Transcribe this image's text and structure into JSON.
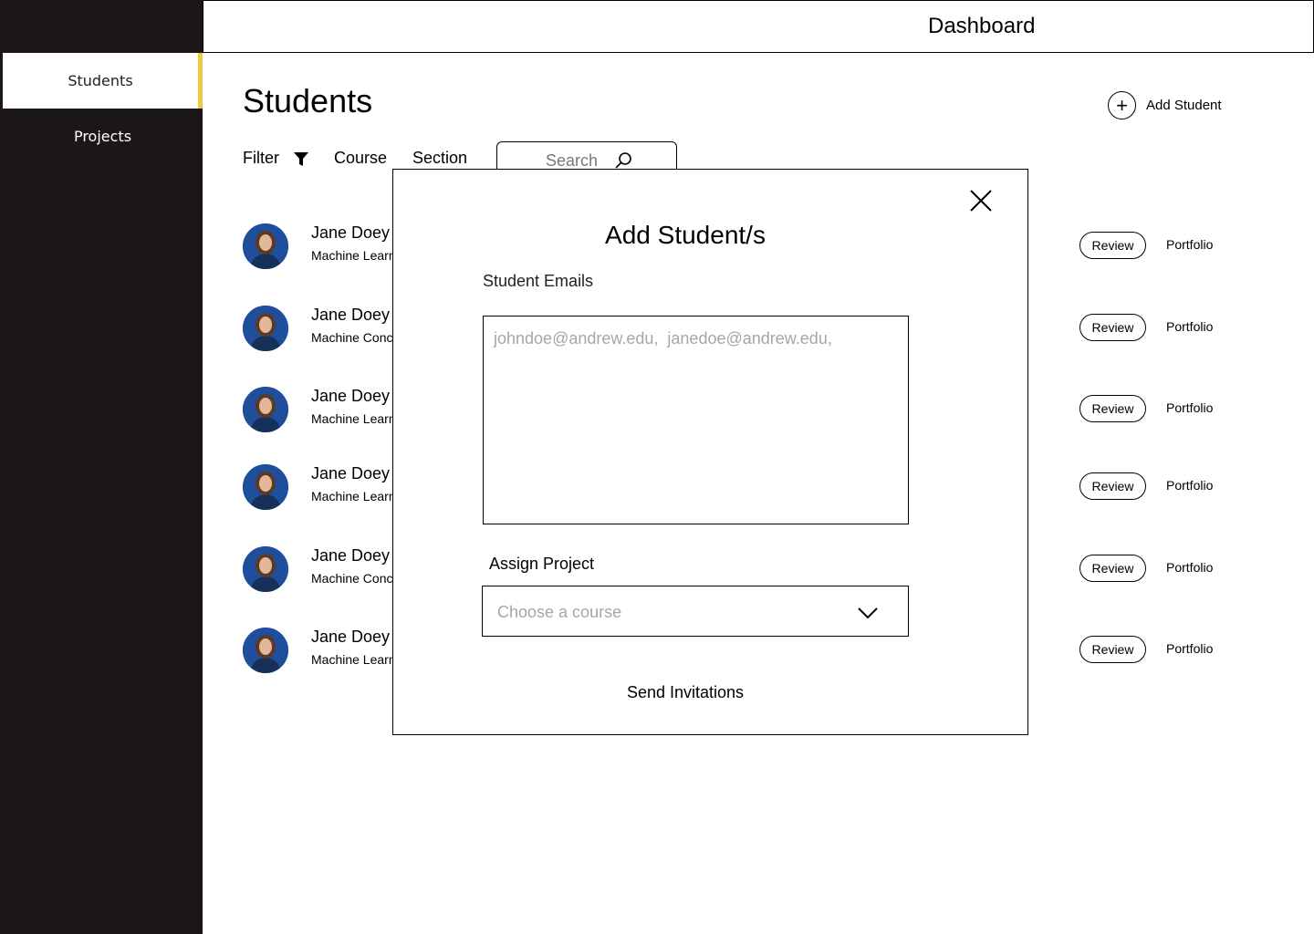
{
  "header": {
    "title": "Dashboard"
  },
  "sidebar": {
    "items": [
      {
        "label": "Students",
        "active": true
      },
      {
        "label": "Projects",
        "active": false
      }
    ],
    "accent": "#f2c641",
    "background": "#1c1717"
  },
  "main": {
    "title": "Students",
    "add_student_label": "Add Student",
    "add_icon": "plus-circle-icon",
    "filters": {
      "filter_label": "Filter",
      "filter_icon": "funnel-icon",
      "course_label": "Course",
      "section_label": "Section",
      "search_placeholder": "Search",
      "search_icon": "search-icon"
    },
    "students": [
      {
        "name": "Jane Doey",
        "course": "Machine Learning",
        "review_label": "Review",
        "portfolio_label": "Portfolio"
      },
      {
        "name": "Jane Doey",
        "course": "Machine Concepts",
        "review_label": "Review",
        "portfolio_label": "Portfolio"
      },
      {
        "name": "Jane Doey",
        "course": "Machine Learning",
        "review_label": "Review",
        "portfolio_label": "Portfolio"
      },
      {
        "name": "Jane Doey",
        "course": "Machine Learning",
        "review_label": "Review",
        "portfolio_label": "Portfolio"
      },
      {
        "name": "Jane Doey",
        "course": "Machine Concepts",
        "review_label": "Review",
        "portfolio_label": "Portfolio"
      },
      {
        "name": "Jane Doey",
        "course": "Machine Learning",
        "review_label": "Review",
        "portfolio_label": "Portfolio"
      }
    ]
  },
  "modal": {
    "title": "Add Student/s",
    "emails_label": "Student Emails",
    "emails_placeholder": "johndoe@andrew.edu,  janedoe@andrew.edu,",
    "assign_label": "Assign Project",
    "course_placeholder": "Choose a course",
    "send_label": "Send Invitations",
    "close_icon": "close-icon",
    "chevron_icon": "chevron-down-icon"
  }
}
